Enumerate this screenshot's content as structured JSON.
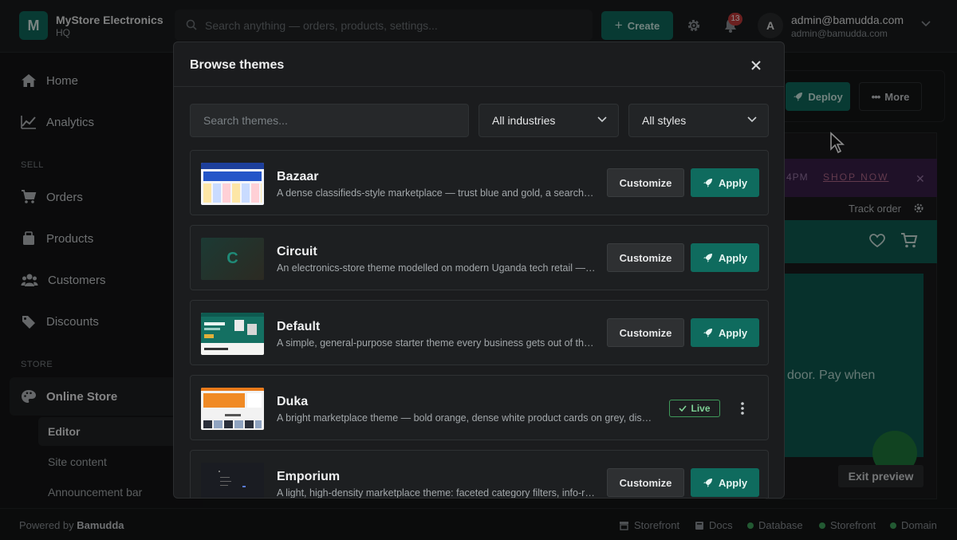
{
  "brand": {
    "logo_letter": "M",
    "name": "MyStore Electronics",
    "subtitle": "HQ"
  },
  "topbar": {
    "search_placeholder": "Search anything — orders, products, settings...",
    "create_label": "Create",
    "notification_count": "13",
    "avatar_letter": "A",
    "user_name": "admin@bamudda.com",
    "user_email": "admin@bamudda.com"
  },
  "sidebar": {
    "top_items": [
      {
        "label": "Home"
      },
      {
        "label": "Analytics"
      }
    ],
    "sell_section": "SELL",
    "sell_items": [
      {
        "label": "Orders"
      },
      {
        "label": "Products"
      },
      {
        "label": "Customers"
      },
      {
        "label": "Discounts"
      }
    ],
    "store_section": "STORE",
    "store_items": [
      {
        "label": "Online Store"
      }
    ],
    "sub_items": [
      {
        "label": "Editor"
      },
      {
        "label": "Site content"
      },
      {
        "label": "Announcement bar"
      }
    ]
  },
  "background": {
    "deploy_label": "Deploy",
    "more_label": "More",
    "promo_time": "4PM",
    "promo_link": "SHOP NOW",
    "track_order": "Track order",
    "hero_text": "door. Pay when",
    "exit_preview": "Exit preview"
  },
  "footer": {
    "powered_prefix": "Powered by",
    "powered_brand": "Bamudda",
    "links": [
      {
        "label": "Storefront"
      },
      {
        "label": "Docs"
      }
    ],
    "status": [
      {
        "label": "Database"
      },
      {
        "label": "Storefront"
      },
      {
        "label": "Domain"
      }
    ],
    "status_color": "#3fa35b"
  },
  "modal": {
    "title": "Browse themes",
    "search_placeholder": "Search themes...",
    "industry_filter": "All industries",
    "style_filter": "All styles",
    "customize_label": "Customize",
    "apply_label": "Apply",
    "live_label": "Live",
    "themes": [
      {
        "name": "Bazaar",
        "description": "A dense classifieds-style marketplace — trust blue and gold, a search-first homepage and category grid."
      },
      {
        "name": "Circuit",
        "thumb_letter": "C",
        "description": "An electronics-store theme modelled on modern Uganda tech retail — dark, sleek product showcases."
      },
      {
        "name": "Default",
        "description": "A simple, general-purpose starter theme every business gets out of the box to start selling."
      },
      {
        "name": "Duka",
        "description": "A bright marketplace theme — bold orange, dense white product cards on grey, discount badges."
      },
      {
        "name": "Emporium",
        "description": "A light, high-density marketplace theme: faceted category filters, info-rich product tiles."
      }
    ]
  },
  "colors": {
    "accent": "#0f6b5e",
    "live": "#3f9a5a",
    "badge": "#c33b3b"
  }
}
